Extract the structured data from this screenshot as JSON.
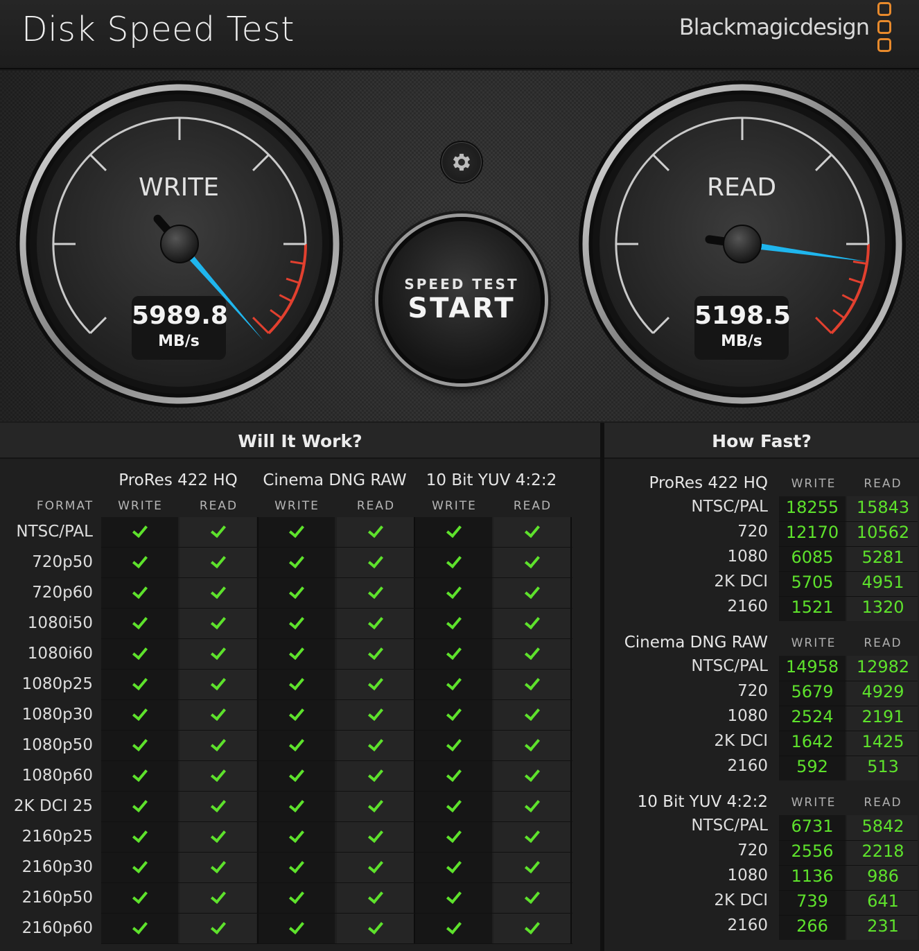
{
  "app": {
    "title": "Disk Speed Test",
    "brand": "Blackmagicdesign",
    "brand_logo_color": "#e88a2c"
  },
  "gauges": {
    "write": {
      "label": "WRITE",
      "value": "5989.8",
      "unit": "MB/s"
    },
    "read": {
      "label": "READ",
      "value": "5198.5",
      "unit": "MB/s"
    }
  },
  "controls": {
    "settings_icon": "gear-icon",
    "start_top": "SPEED TEST",
    "start_main": "START"
  },
  "will_it_work": {
    "title": "Will It Work?",
    "format_caption": "FORMAT",
    "codecs": [
      "ProRes 422 HQ",
      "Cinema DNG RAW",
      "10 Bit YUV 4:2:2"
    ],
    "write_caption": "WRITE",
    "read_caption": "READ",
    "formats": [
      "NTSC/PAL",
      "720p50",
      "720p60",
      "1080i50",
      "1080i60",
      "1080p25",
      "1080p30",
      "1080p50",
      "1080p60",
      "2K DCI 25",
      "2160p25",
      "2160p30",
      "2160p50",
      "2160p60"
    ],
    "check_color": "#5ee22c"
  },
  "how_fast": {
    "title": "How Fast?",
    "write_caption": "WRITE",
    "read_caption": "READ",
    "groups": [
      {
        "name": "ProRes 422 HQ",
        "rows": [
          {
            "label": "NTSC/PAL",
            "write": "18255",
            "read": "15843"
          },
          {
            "label": "720",
            "write": "12170",
            "read": "10562"
          },
          {
            "label": "1080",
            "write": "6085",
            "read": "5281"
          },
          {
            "label": "2K DCI",
            "write": "5705",
            "read": "4951"
          },
          {
            "label": "2160",
            "write": "1521",
            "read": "1320"
          }
        ]
      },
      {
        "name": "Cinema DNG RAW",
        "rows": [
          {
            "label": "NTSC/PAL",
            "write": "14958",
            "read": "12982"
          },
          {
            "label": "720",
            "write": "5679",
            "read": "4929"
          },
          {
            "label": "1080",
            "write": "2524",
            "read": "2191"
          },
          {
            "label": "2K DCI",
            "write": "1642",
            "read": "1425"
          },
          {
            "label": "2160",
            "write": "592",
            "read": "513"
          }
        ]
      },
      {
        "name": "10 Bit YUV 4:2:2",
        "rows": [
          {
            "label": "NTSC/PAL",
            "write": "6731",
            "read": "5842"
          },
          {
            "label": "720",
            "write": "2556",
            "read": "2218"
          },
          {
            "label": "1080",
            "write": "1136",
            "read": "986"
          },
          {
            "label": "2K DCI",
            "write": "739",
            "read": "641"
          },
          {
            "label": "2160",
            "write": "266",
            "read": "231"
          }
        ]
      }
    ]
  }
}
